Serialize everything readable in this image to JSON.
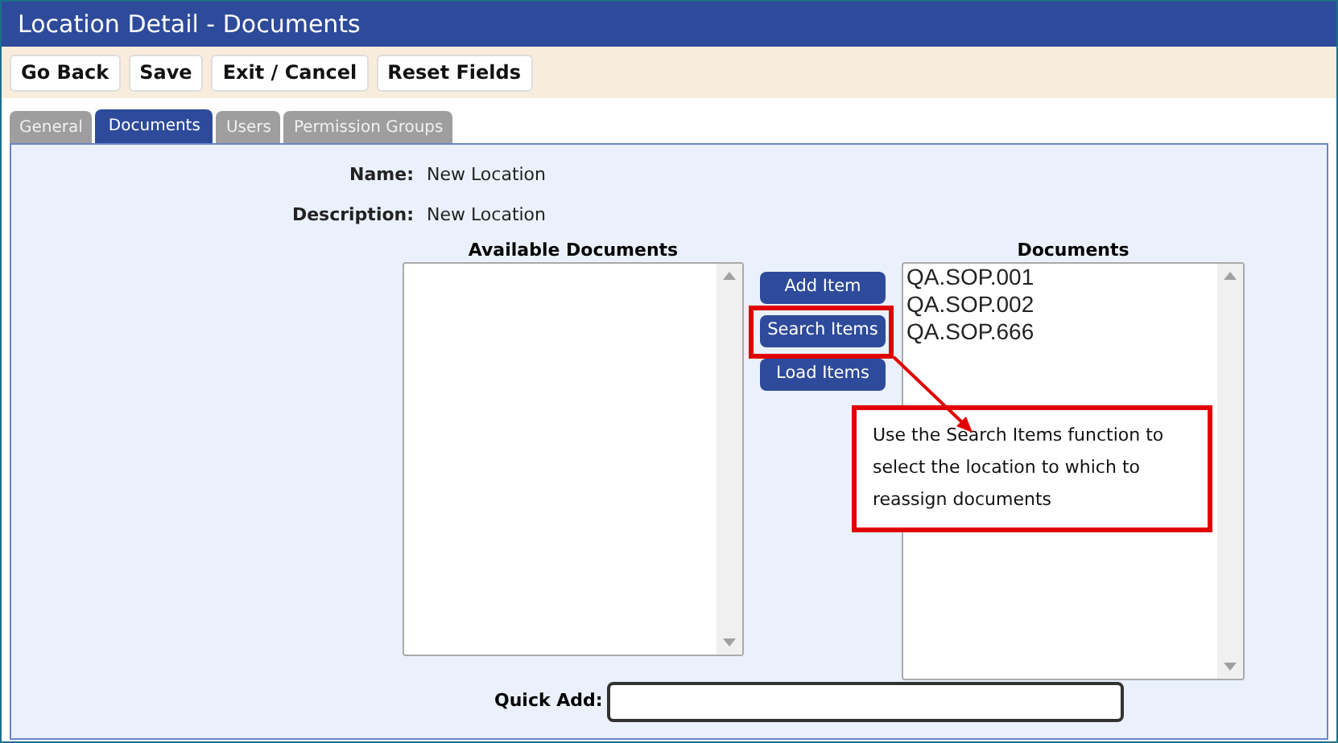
{
  "window": {
    "title": "Location Detail - Documents"
  },
  "toolbar": [
    "Go Back",
    "Save",
    "Exit / Cancel",
    "Reset Fields"
  ],
  "tabs": [
    {
      "label": "General",
      "selected": false
    },
    {
      "label": "Documents",
      "selected": true
    },
    {
      "label": "Users",
      "selected": false
    },
    {
      "label": "Permission Groups",
      "selected": false
    }
  ],
  "fields": [
    {
      "label": "Name:",
      "value": "New Location"
    },
    {
      "label": "Description:",
      "value": "New Location"
    }
  ],
  "available_documents": {
    "heading": "Available Documents"
  },
  "actions": [
    "Add Item",
    "Search Items",
    "Load Items"
  ],
  "documents": {
    "heading": "Documents",
    "items": [
      "QA.SOP.001",
      "QA.SOP.002",
      "QA.SOP.666"
    ]
  },
  "quick_add": {
    "label": "Quick Add:"
  },
  "callout": {
    "text": "Use the Search Items function to select the location to which to reassign documents"
  }
}
